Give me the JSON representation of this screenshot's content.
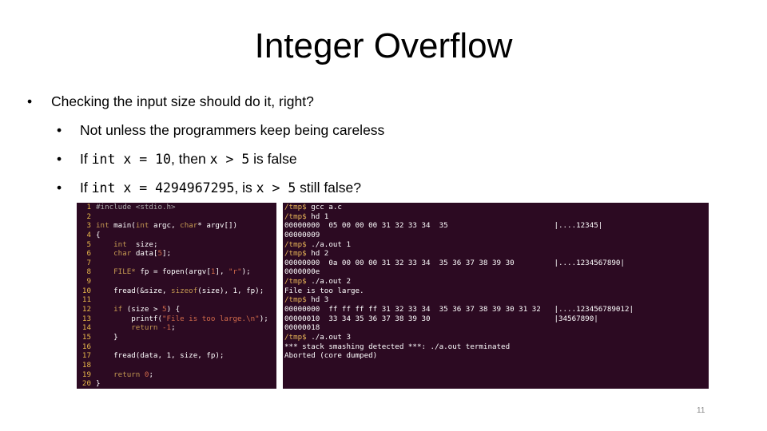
{
  "slide": {
    "title": "Integer Overflow",
    "number": "11"
  },
  "bullets": [
    {
      "level": 1,
      "parts": [
        {
          "t": "Checking the input size should do it, right?",
          "mono": false
        }
      ]
    },
    {
      "level": 2,
      "parts": [
        {
          "t": "Not unless the programmers keep being careless",
          "mono": false
        }
      ]
    },
    {
      "level": 2,
      "parts": [
        {
          "t": "If ",
          "mono": false
        },
        {
          "t": "int x = 10",
          "mono": true
        },
        {
          "t": ", then ",
          "mono": false
        },
        {
          "t": "x > 5",
          "mono": true
        },
        {
          "t": " is false",
          "mono": false
        }
      ]
    },
    {
      "level": 2,
      "parts": [
        {
          "t": "If ",
          "mono": false
        },
        {
          "t": "int x = 4294967295",
          "mono": true
        },
        {
          "t": ", is ",
          "mono": false
        },
        {
          "t": "x > 5",
          "mono": true
        },
        {
          "t": " still false?",
          "mono": false
        }
      ]
    }
  ],
  "bullet_glyph": "•",
  "code_panel": {
    "background": "#2c0a22",
    "lines": [
      {
        "n": "1",
        "segs": [
          {
            "c": "pre",
            "t": "#include <stdio.h>"
          }
        ]
      },
      {
        "n": "2",
        "segs": []
      },
      {
        "n": "3",
        "segs": [
          {
            "c": "kw",
            "t": "int"
          },
          {
            "c": "",
            "t": " main("
          },
          {
            "c": "kw",
            "t": "int"
          },
          {
            "c": "",
            "t": " argc, "
          },
          {
            "c": "kw",
            "t": "char"
          },
          {
            "c": "",
            "t": "* argv[])"
          }
        ]
      },
      {
        "n": "4",
        "segs": [
          {
            "c": "",
            "t": "{"
          }
        ]
      },
      {
        "n": "5",
        "segs": [
          {
            "c": "",
            "t": "    "
          },
          {
            "c": "kw",
            "t": "int"
          },
          {
            "c": "",
            "t": "  size;"
          }
        ]
      },
      {
        "n": "6",
        "segs": [
          {
            "c": "",
            "t": "    "
          },
          {
            "c": "kw",
            "t": "char"
          },
          {
            "c": "",
            "t": " data["
          },
          {
            "c": "str",
            "t": "5"
          },
          {
            "c": "",
            "t": "];"
          }
        ]
      },
      {
        "n": "7",
        "segs": []
      },
      {
        "n": "8",
        "segs": [
          {
            "c": "",
            "t": "    "
          },
          {
            "c": "kw",
            "t": "FILE*"
          },
          {
            "c": "",
            "t": " fp = fopen(argv["
          },
          {
            "c": "str",
            "t": "1"
          },
          {
            "c": "",
            "t": "], "
          },
          {
            "c": "str",
            "t": "\"r\""
          },
          {
            "c": "",
            "t": ");"
          }
        ]
      },
      {
        "n": "9",
        "segs": []
      },
      {
        "n": "10",
        "segs": [
          {
            "c": "",
            "t": "    fread(&size, "
          },
          {
            "c": "kw",
            "t": "sizeof"
          },
          {
            "c": "",
            "t": "(size), 1, fp);"
          }
        ]
      },
      {
        "n": "11",
        "segs": []
      },
      {
        "n": "12",
        "segs": [
          {
            "c": "",
            "t": "    "
          },
          {
            "c": "kw",
            "t": "if"
          },
          {
            "c": "",
            "t": " (size > "
          },
          {
            "c": "str",
            "t": "5"
          },
          {
            "c": "",
            "t": ") {"
          }
        ]
      },
      {
        "n": "13",
        "segs": [
          {
            "c": "",
            "t": "        printf("
          },
          {
            "c": "str",
            "t": "\"File is too large.\\n\""
          },
          {
            "c": "",
            "t": ");"
          }
        ]
      },
      {
        "n": "14",
        "segs": [
          {
            "c": "",
            "t": "        "
          },
          {
            "c": "kw",
            "t": "return"
          },
          {
            "c": "",
            "t": " "
          },
          {
            "c": "str",
            "t": "-1"
          },
          {
            "c": "",
            "t": ";"
          }
        ]
      },
      {
        "n": "15",
        "segs": [
          {
            "c": "",
            "t": "    }"
          }
        ]
      },
      {
        "n": "16",
        "segs": []
      },
      {
        "n": "17",
        "segs": [
          {
            "c": "",
            "t": "    fread(data, 1, size, fp);"
          }
        ]
      },
      {
        "n": "18",
        "segs": []
      },
      {
        "n": "19",
        "segs": [
          {
            "c": "",
            "t": "    "
          },
          {
            "c": "kw",
            "t": "return"
          },
          {
            "c": "",
            "t": " "
          },
          {
            "c": "str",
            "t": "0"
          },
          {
            "c": "",
            "t": ";"
          }
        ]
      },
      {
        "n": "20",
        "segs": [
          {
            "c": "",
            "t": "}"
          }
        ]
      }
    ]
  },
  "terminal": {
    "background": "#2c0a22",
    "prompt": "/tmp$",
    "lines": [
      {
        "type": "cmd",
        "text": "gcc a.c"
      },
      {
        "type": "cmd",
        "text": "hd 1"
      },
      {
        "type": "hex",
        "offset": "00000000",
        "bytes": "05 00 00 00 31 32 33 34  35",
        "ascii": "|....12345|"
      },
      {
        "type": "hex",
        "offset": "00000009",
        "bytes": "",
        "ascii": ""
      },
      {
        "type": "cmd",
        "text": "./a.out 1"
      },
      {
        "type": "cmd",
        "text": "hd 2"
      },
      {
        "type": "hex",
        "offset": "00000000",
        "bytes": "0a 00 00 00 31 32 33 34  35 36 37 38 39 30",
        "ascii": "|....1234567890|"
      },
      {
        "type": "hex",
        "offset": "0000000e",
        "bytes": "",
        "ascii": ""
      },
      {
        "type": "cmd",
        "text": "./a.out 2"
      },
      {
        "type": "out",
        "text": "File is too large."
      },
      {
        "type": "cmd",
        "text": "hd 3"
      },
      {
        "type": "hex",
        "offset": "00000000",
        "bytes": "ff ff ff ff 31 32 33 34  35 36 37 38 39 30 31 32",
        "ascii": "|....123456789012|"
      },
      {
        "type": "hex",
        "offset": "00000010",
        "bytes": "33 34 35 36 37 38 39 30",
        "ascii": "|34567890|"
      },
      {
        "type": "hex",
        "offset": "00000018",
        "bytes": "",
        "ascii": ""
      },
      {
        "type": "cmd",
        "text": "./a.out 3"
      },
      {
        "type": "out",
        "text": "*** stack smashing detected ***: ./a.out terminated"
      },
      {
        "type": "out",
        "text": "Aborted (core dumped)"
      }
    ]
  }
}
